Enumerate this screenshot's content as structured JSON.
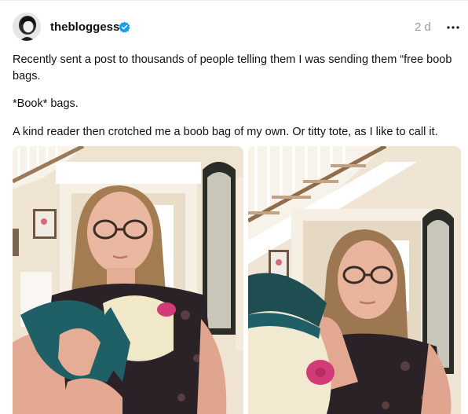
{
  "post": {
    "author": {
      "username": "thebloggess",
      "verified": true,
      "avatar_icon": "avatar-photo-icon",
      "verified_icon": "verified-badge-icon"
    },
    "timestamp": "2 d",
    "more_icon": "more-options-icon",
    "paragraphs": [
      "Recently sent a post to thousands of people telling them I was sending them “free boob bags.",
      "*Book* bags.",
      "A kind reader then crotched me a boob bag of my own. Or titty tote, as I like to call it."
    ],
    "media_count": 2
  },
  "colors": {
    "verified_blue": "#1d9bf0",
    "timestamp_gray": "#999999",
    "text": "#101010"
  }
}
